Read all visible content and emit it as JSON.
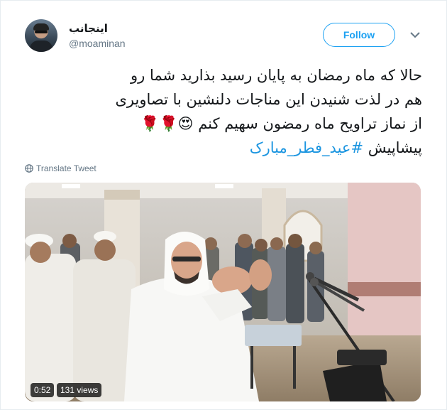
{
  "tweet": {
    "display_name": "اینجانب",
    "handle": "@moaminan",
    "follow_label": "Follow",
    "text_line_1": "حالا که ماه رمضان به پایان رسید بذارید شما رو",
    "text_line_2": "هم در لذت شنیدن این مناجات دلنشین با تصاویری",
    "text_line_3": "از نماز تراویح ماه رمضون سهیم کنم 😍🌹🌹",
    "text_line_4_prefix": "پیشاپیش ",
    "hashtag": "#عید_فطر_مبارک",
    "translate_label": "Translate Tweet"
  },
  "video": {
    "duration": "0:52",
    "views": "131 views"
  },
  "colors": {
    "accent": "#1da1f2",
    "hashtag": "#1b95e0",
    "text": "#14171a",
    "muted": "#657786"
  },
  "icons": {
    "caret": "chevron-down-icon",
    "translate": "globe-icon"
  }
}
